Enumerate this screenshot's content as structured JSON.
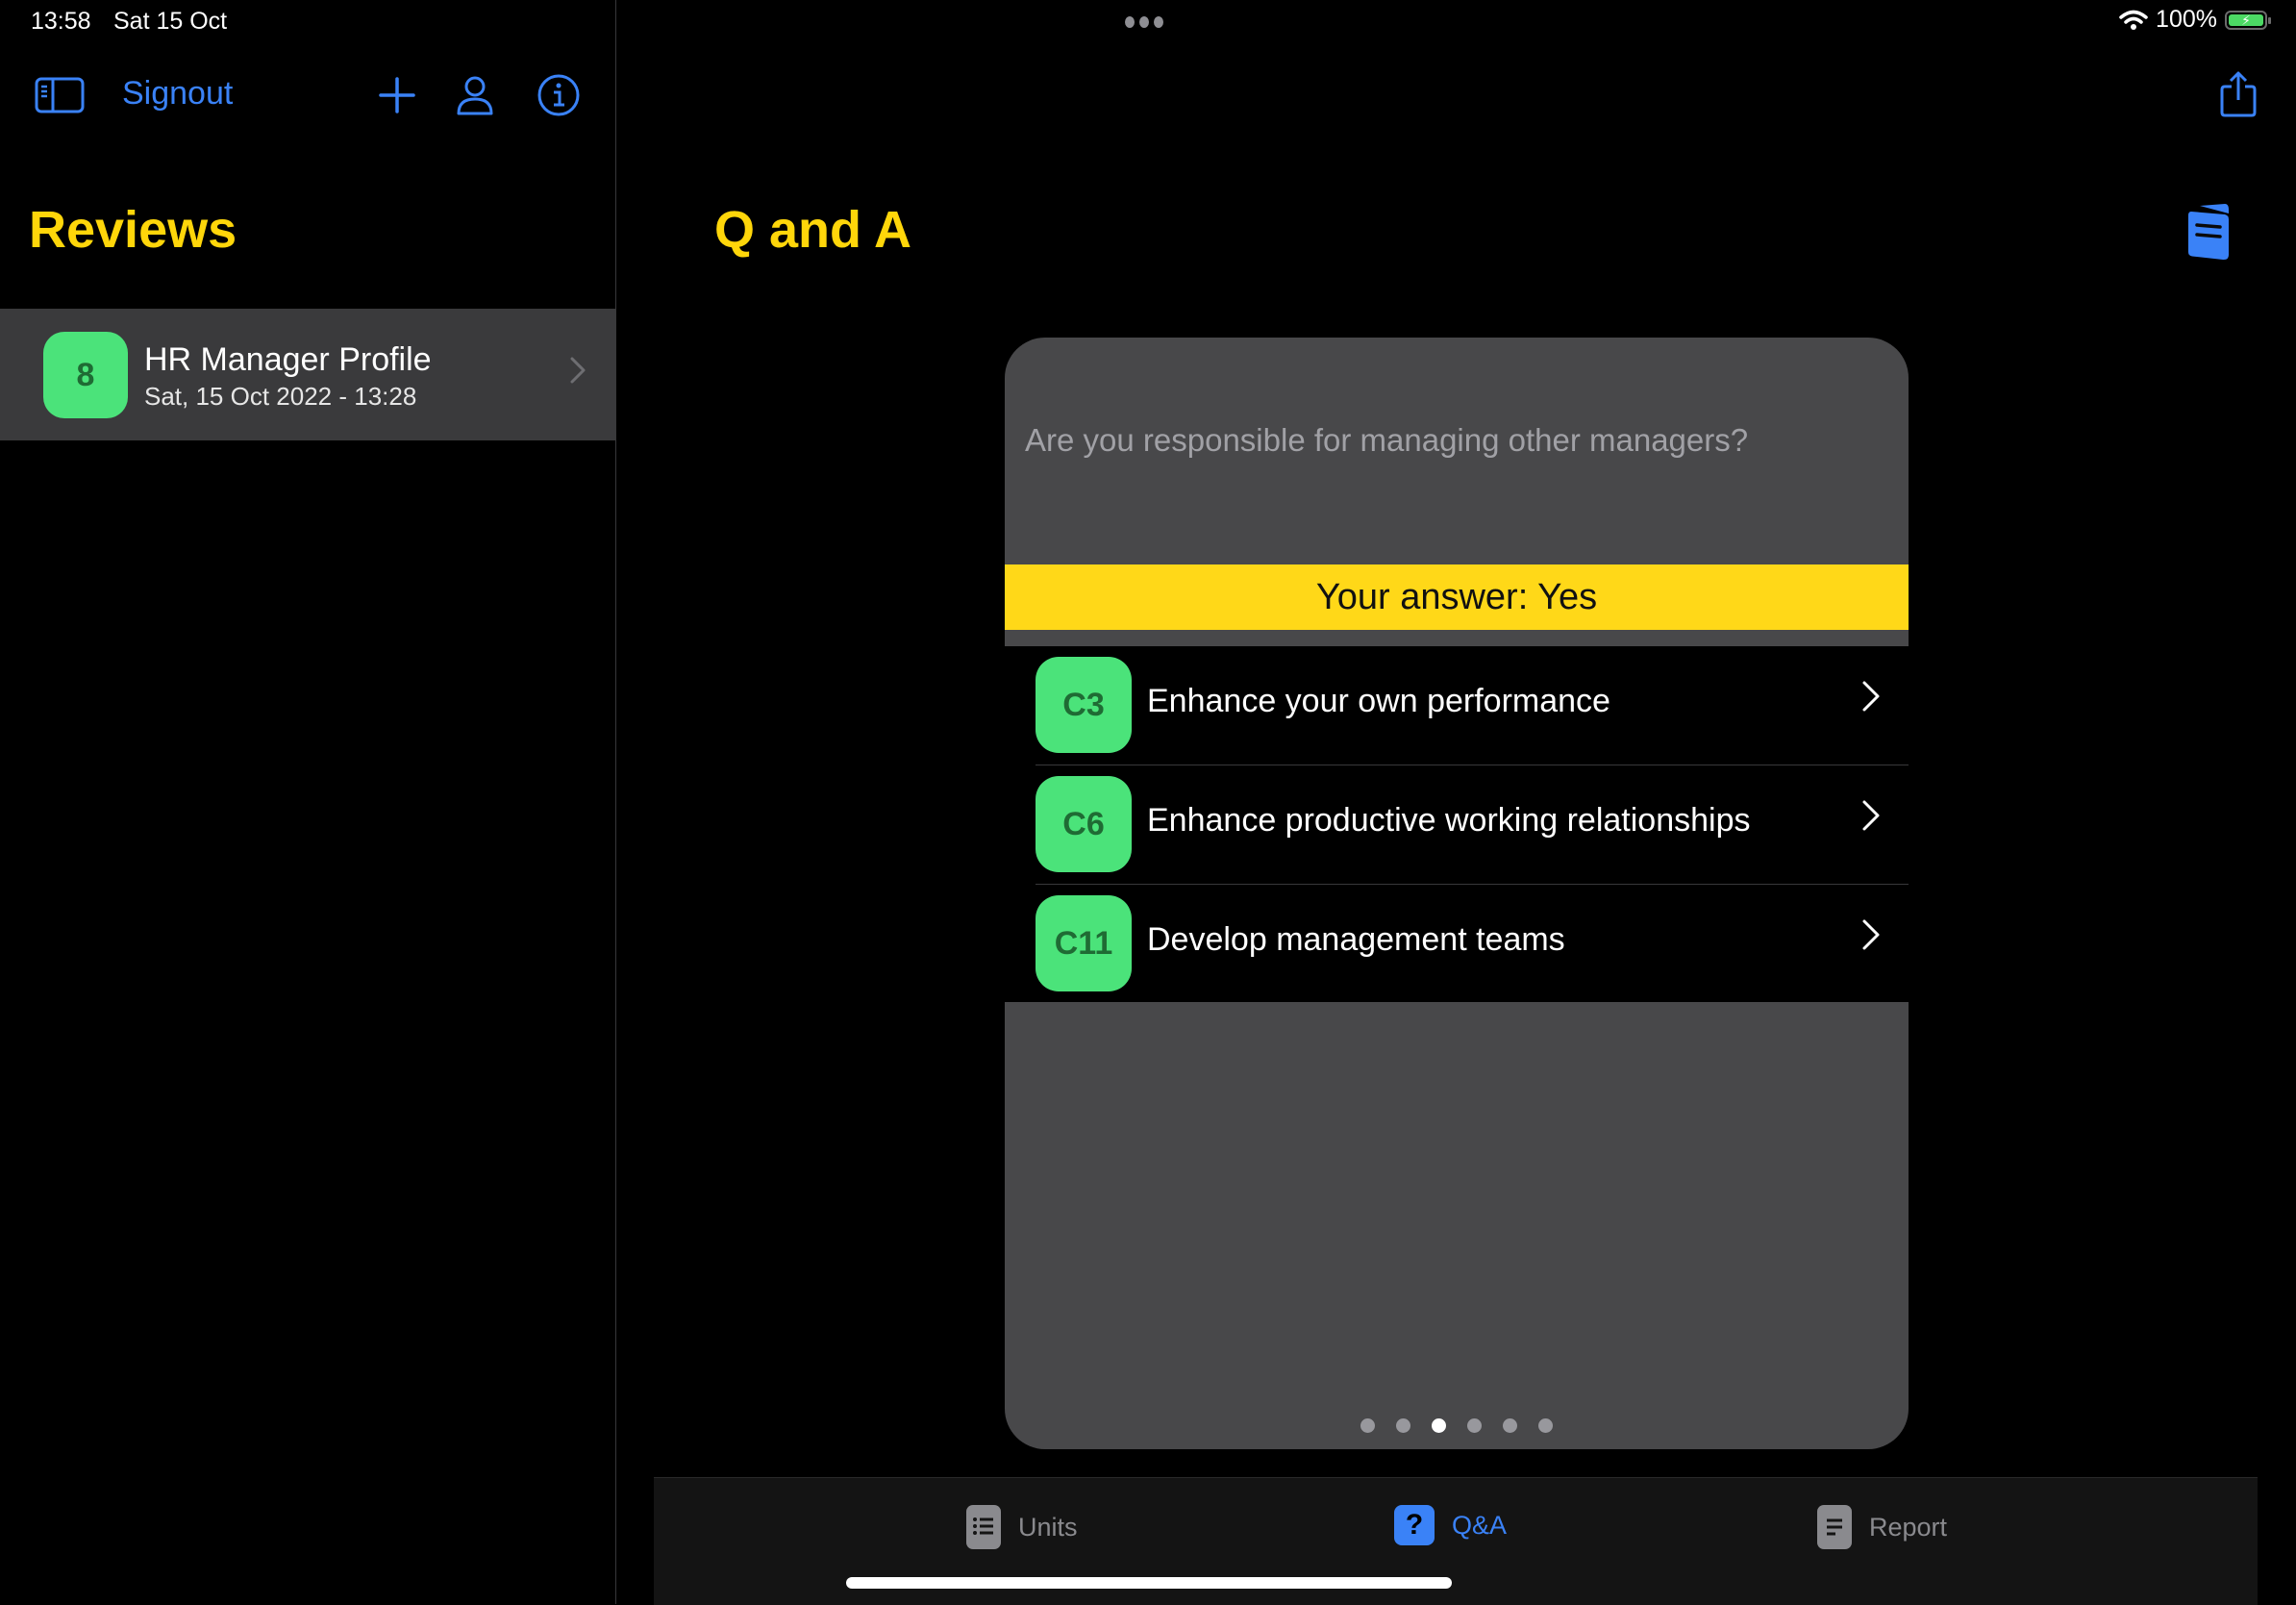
{
  "status_bar": {
    "time": "13:58",
    "date": "Sat 15 Oct",
    "battery_percent": "100%",
    "battery_level": 1.0,
    "charging": true
  },
  "sidebar": {
    "toolbar": {
      "sidebar_toggle_icon": "sidebar-left-icon",
      "signout_label": "Signout",
      "add_icon": "plus-icon",
      "profile_icon": "person-icon",
      "info_icon": "info-circle-icon"
    },
    "title": "Reviews",
    "reviews": [
      {
        "badge": "8",
        "title": "HR Manager Profile",
        "subtitle": "Sat, 15 Oct 2022 - 13:28",
        "selected": true
      }
    ]
  },
  "detail": {
    "title": "Q and A",
    "share_icon": "share-icon",
    "document_icon": "document-icon",
    "card": {
      "question": "Are you responsible for managing other managers?",
      "answer": "Your answer: Yes",
      "units": [
        {
          "code": "C3",
          "label": "Enhance your own performance"
        },
        {
          "code": "C6",
          "label": "Enhance productive working relationships"
        },
        {
          "code": "C11",
          "label": "Develop management teams"
        }
      ],
      "page_count": 6,
      "current_page": 3
    }
  },
  "tabbar": {
    "tabs": [
      {
        "label": "Units",
        "icon": "list-icon",
        "active": false
      },
      {
        "label": "Q&A",
        "icon": "question-icon",
        "active": true
      },
      {
        "label": "Report",
        "icon": "report-icon",
        "active": false
      }
    ]
  },
  "colors": {
    "accent": "#3a82f7",
    "title_yellow": "#ffd60a",
    "answer_yellow": "#ffd818",
    "badge_green": "#4be37a",
    "badge_text": "#1f6b34",
    "card_bg": "#48484a",
    "selected_row_bg": "#3a3a3c"
  }
}
